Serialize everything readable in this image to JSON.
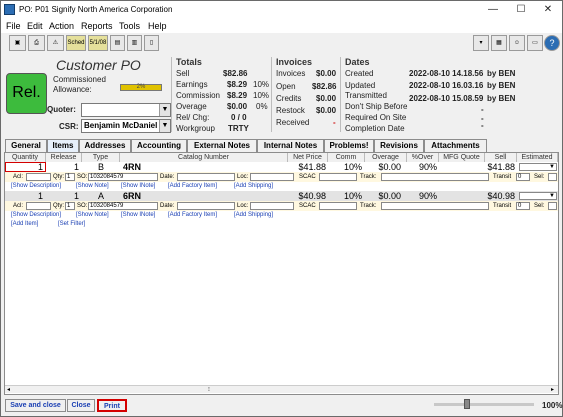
{
  "window": {
    "title": "PO: P01   Signify North America Corporation",
    "buttons": [
      "—",
      "☐",
      "✕"
    ]
  },
  "menu": [
    "File",
    "Edit",
    "Action",
    "Reports",
    "Tools",
    "Help"
  ],
  "toolbar": {
    "sched": "Sched",
    "date": "5/1/08"
  },
  "header": {
    "status": "Rel.",
    "title": "Customer PO",
    "commissioned_label": "Commissioned",
    "allowance_label": "Allowance:",
    "allowance_value": "2%",
    "quoter_label": "Quoter:",
    "quoter_value": "",
    "csr_label": "CSR:",
    "csr_value": "Benjamin McDaniel"
  },
  "totals": {
    "title": "Totals",
    "rows": [
      {
        "label": "Sell",
        "value": "$82.86",
        "pct": ""
      },
      {
        "label": "Earnings",
        "value": "$8.29",
        "pct": "10%"
      },
      {
        "label": "Commission",
        "value": "$8.29",
        "pct": "10%"
      },
      {
        "label": "Overage",
        "value": "$0.00",
        "pct": "0%"
      },
      {
        "label": "Rel/ Chg:",
        "value": "0 / 0",
        "pct": ""
      },
      {
        "label": "Workgroup",
        "value": "TRTY",
        "pct": ""
      }
    ]
  },
  "invoices": {
    "title": "Invoices",
    "rows": [
      {
        "label": "Invoices",
        "value": "$0.00"
      },
      {
        "label": "Open",
        "value": "$82.86"
      },
      {
        "label": "Credits",
        "value": "$0.00"
      },
      {
        "label": "Restock",
        "value": "$0.00"
      },
      {
        "label": "Received",
        "value": "-"
      }
    ]
  },
  "dates": {
    "title": "Dates",
    "rows": [
      {
        "label": "Created",
        "value": "2022-08-10 14.18.56",
        "by": "by BEN"
      },
      {
        "label": "Updated",
        "value": "2022-08-10 16.03.16",
        "by": "by BEN"
      },
      {
        "label": "Transmitted",
        "value": "2022-08-10 15.08.59",
        "by": "by BEN"
      },
      {
        "label": "Don't Ship Before",
        "value": "-",
        "by": ""
      },
      {
        "label": "Required On Site",
        "value": "-",
        "by": ""
      },
      {
        "label": "Completion Date",
        "value": "-",
        "by": ""
      }
    ]
  },
  "tabs": [
    "General",
    "Items",
    "Addresses",
    "Accounting",
    "External Notes",
    "Internal Notes",
    "Problems!",
    "Revisions",
    "Attachments"
  ],
  "grid": {
    "headers": [
      "Quantity",
      "Release",
      "Type",
      "Catalog Number",
      "Net Price",
      "Comm",
      "Overage",
      "%Over",
      "MFG Quote",
      "Sell",
      "Estimated"
    ],
    "rows": [
      {
        "quantity": "1",
        "release": "1",
        "type": "B",
        "catalog": "4RN",
        "net_price": "$41.88",
        "comm": "10%",
        "overage": "$0.00",
        "over_pct": "90%",
        "sell": "$41.88",
        "acl": "Acl:",
        "qty_label": "Qty:",
        "qty": "1",
        "so_label": "SO:",
        "so": "1032084579",
        "date_label": "Date:",
        "loc_label": "Loc:",
        "scac_label": "SCAC",
        "track_label": "Track:",
        "transit_label": "Transit",
        "transit": "0",
        "sel_label": "Sel:",
        "links": [
          "[Show Description]",
          "[Show Note]",
          "[Show INote]",
          "[Add Factory Item]",
          "[Add Shipping]"
        ]
      },
      {
        "quantity": "1",
        "release": "1",
        "type": "A",
        "catalog": "6RN",
        "net_price": "$40.98",
        "comm": "10%",
        "overage": "$0.00",
        "over_pct": "90%",
        "sell": "$40.98",
        "acl": "Acl:",
        "qty_label": "Qty:",
        "qty": "1",
        "so_label": "SO:",
        "so": "1032084579",
        "date_label": "Date:",
        "loc_label": "Loc:",
        "scac_label": "SCAC",
        "track_label": "Track:",
        "transit_label": "Transit",
        "transit": "0",
        "sel_label": "Sel:",
        "links": [
          "[Show Description]",
          "[Show Note]",
          "[Show INote]",
          "[Add Factory Item]",
          "[Add Shipping]"
        ]
      }
    ],
    "footer_links": [
      "[Add Item]",
      "[Set Filter]"
    ]
  },
  "bottom": {
    "save_close": "Save and close",
    "close": "Close",
    "print": "Print",
    "zoom": "100%"
  }
}
